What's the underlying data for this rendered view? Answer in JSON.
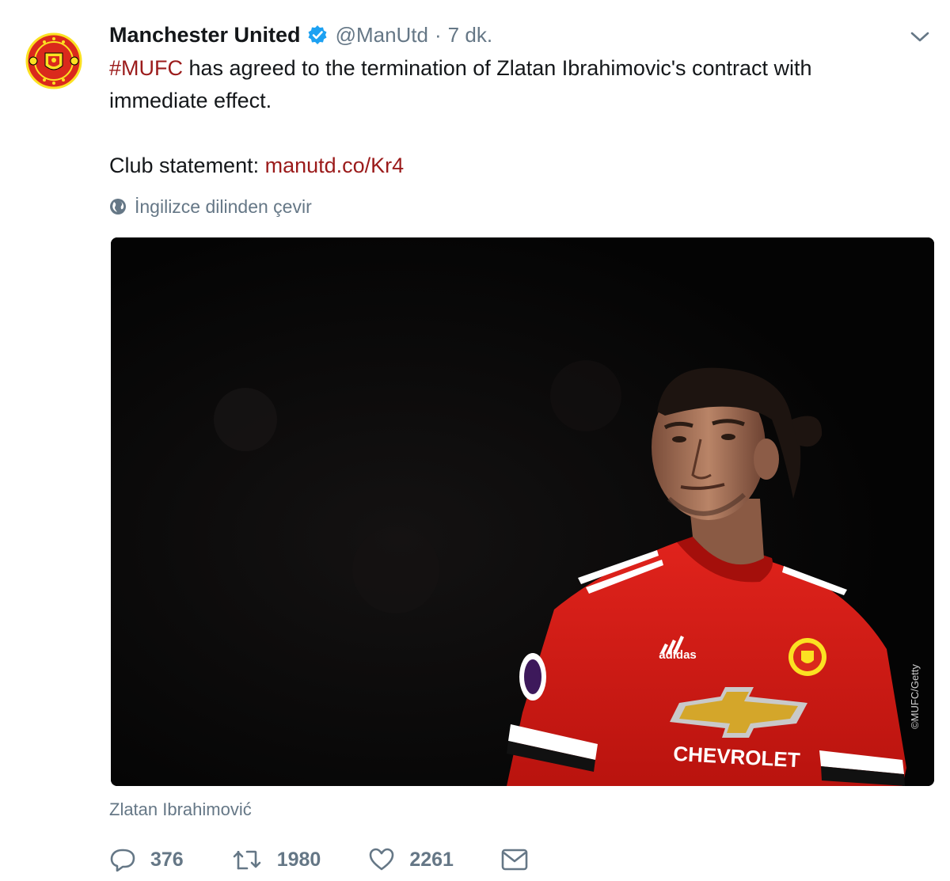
{
  "account": {
    "display_name": "Manchester United",
    "handle": "@ManUtd",
    "separator": "·",
    "time": "7 dk."
  },
  "tweet": {
    "hashtag": "#MUFC",
    "text_line1_rest": " has agreed to the termination of Zlatan Ibrahimovic's contract with",
    "text_line2": "immediate effect.",
    "statement_label": "Club statement: ",
    "link": "manutd.co/Kr4"
  },
  "translate": {
    "label": "İngilizce dilinden çevir"
  },
  "media": {
    "sponsor_text": "CHEVROLET",
    "brand_text": "adidas",
    "credit": "©MUFC/Getty"
  },
  "caption": "Zlatan Ibrahimović",
  "actions": {
    "reply_count": "376",
    "retweet_count": "1980",
    "like_count": "2261"
  },
  "icons": {
    "verified": "verified-badge-icon",
    "caret": "chevron-down-icon",
    "globe": "globe-icon",
    "reply": "reply-icon",
    "retweet": "retweet-icon",
    "like": "heart-icon",
    "dm": "envelope-icon"
  },
  "colors": {
    "link": "#9b1b1b",
    "muted": "#657786",
    "verified": "#1da1f2",
    "club_red": "#da291c",
    "club_gold": "#fbe122"
  }
}
